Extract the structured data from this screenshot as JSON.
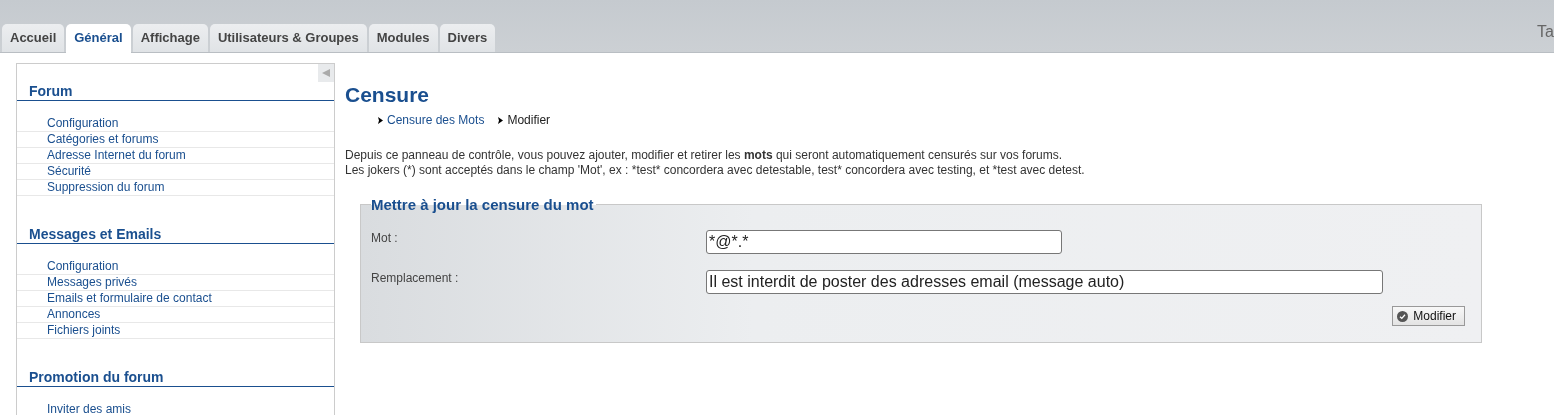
{
  "tabs": [
    {
      "label": "Accueil",
      "selected": false
    },
    {
      "label": "Général",
      "selected": true
    },
    {
      "label": "Affichage",
      "selected": false
    },
    {
      "label": "Utilisateurs & Groupes",
      "selected": false
    },
    {
      "label": "Modules",
      "selected": false
    },
    {
      "label": "Divers",
      "selected": false
    }
  ],
  "top_right_text": "Ta",
  "sidebar": {
    "sections": [
      {
        "title": "Forum",
        "items": [
          "Configuration",
          "Catégories et forums",
          "Adresse Internet du forum",
          "Sécurité",
          "Suppression du forum"
        ]
      },
      {
        "title": "Messages et Emails",
        "items": [
          "Configuration",
          "Messages privés",
          "Emails et formulaire de contact",
          "Annonces",
          "Fichiers joints"
        ]
      },
      {
        "title": "Promotion du forum",
        "items": [
          "Inviter des amis"
        ]
      }
    ]
  },
  "page": {
    "title": "Censure",
    "breadcrumb": [
      {
        "label": "Censure des Mots",
        "kind": "link"
      },
      {
        "label": "Modifier",
        "kind": "current"
      }
    ],
    "description": [
      {
        "text": "Depuis ce panneau de contrôle, vous pouvez ajouter, modifier et retirer les **mots** qui seront automatiquement censurés sur vos forums.",
        "markup": true
      },
      {
        "text": "Les jokers (*) sont acceptés dans le champ 'Mot', ex : *test* concordera avec detestable, test* concordera avec testing, et *test avec detest.",
        "markup": false
      }
    ],
    "form": {
      "legend": "Mettre à jour la censure du mot",
      "fields": [
        {
          "label": "Mot :",
          "value": "*@*.*",
          "kind": "short"
        },
        {
          "label": "Remplacement :",
          "value": "Il est interdit de poster des adresses email (message auto)",
          "kind": "long"
        }
      ],
      "submit": "Modifier"
    }
  }
}
